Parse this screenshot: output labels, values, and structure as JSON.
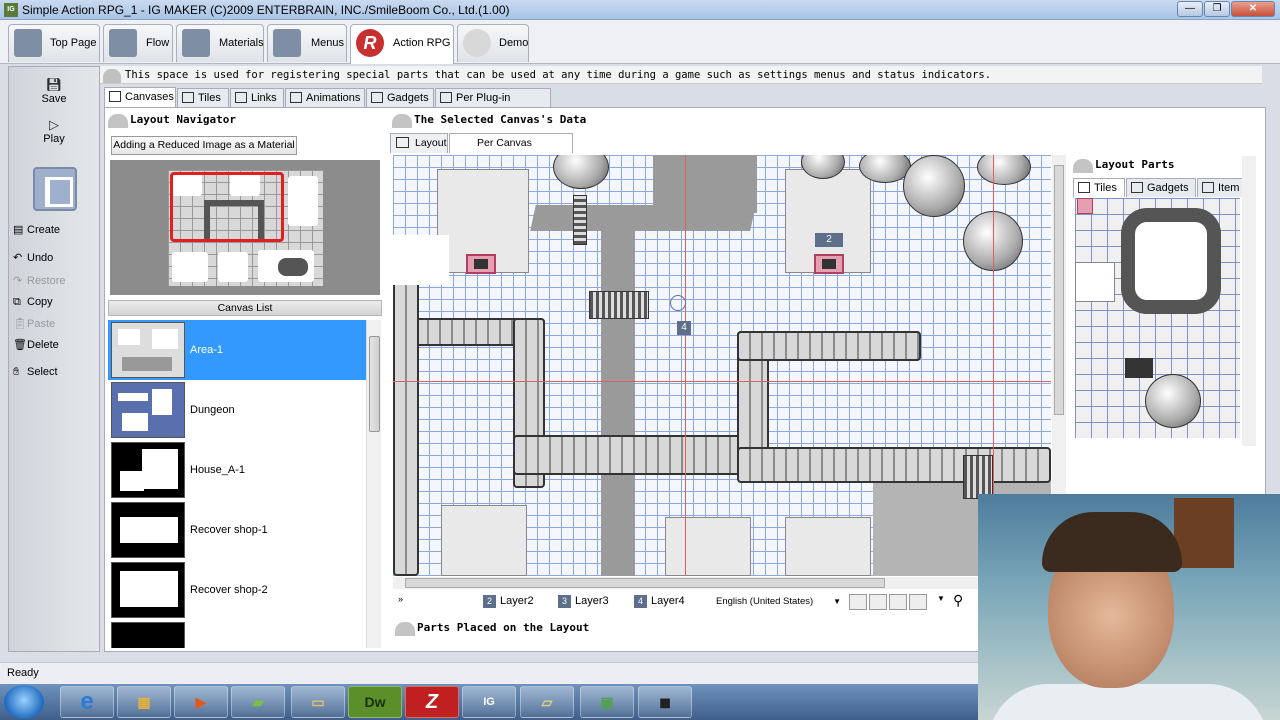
{
  "window": {
    "title": "Simple Action RPG_1 - IG MAKER (C)2009 ENTERBRAIN, INC./SmileBoom Co., Ltd.(1.00)"
  },
  "main_tabs": [
    {
      "label": "Top Page"
    },
    {
      "label": "Flow"
    },
    {
      "label": "Materials"
    },
    {
      "label": "Menus"
    },
    {
      "label": "Action RPG"
    },
    {
      "label": "Demo"
    }
  ],
  "toolbar": {
    "save": "Save",
    "play": "Play",
    "create": "Create",
    "undo": "Undo",
    "restore": "Restore",
    "copy": "Copy",
    "paste": "Paste",
    "delete": "Delete",
    "select": "Select"
  },
  "info_text": "This space is used for registering special parts that can be used at any time during a game such as settings menus and status indicators.",
  "sub_tabs": [
    "Canvases",
    "Tiles",
    "Links",
    "Animations",
    "Gadgets",
    "Per Plug-in Settings"
  ],
  "layout_navigator": {
    "title": "Layout Navigator",
    "button": "Adding a Reduced Image as a Material"
  },
  "canvas_list": {
    "header": "Canvas List",
    "items": [
      "Area-1",
      "Dungeon",
      "House_A-1",
      "Recover shop-1",
      "Recover shop-2"
    ]
  },
  "selected_canvas": {
    "title": "The Selected Canvas's Data",
    "tabs": [
      "Layout",
      "Per Canvas Settings"
    ]
  },
  "map_marker": "2",
  "map_marker_2": "4",
  "layers": [
    {
      "num": "2",
      "label": "Layer2"
    },
    {
      "num": "3",
      "label": "Layer3"
    },
    {
      "num": "4",
      "label": "Layer4"
    }
  ],
  "language": "English (United States)",
  "parts_placed": "Parts Placed on the Layout",
  "layout_parts": {
    "title": "Layout Parts",
    "tabs": [
      "Tiles",
      "Gadgets",
      "Item"
    ]
  },
  "status": "Ready",
  "taskbar_apps": [
    "IE",
    "Explorer",
    "Media",
    "Game",
    "Folder",
    "Dw",
    "Fz",
    "IG MAKER",
    "Notes",
    "Monitor",
    "Camera"
  ]
}
